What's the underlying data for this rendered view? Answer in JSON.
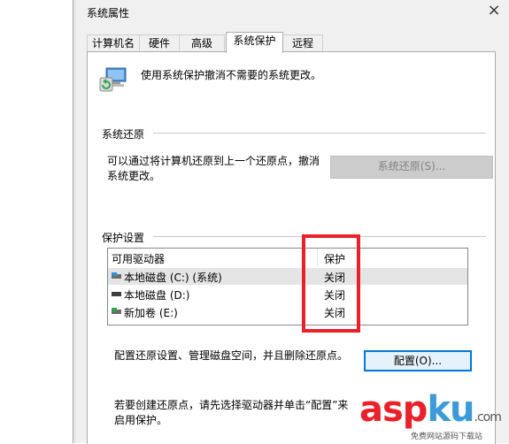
{
  "dialog": {
    "title": "系统属性",
    "close_glyph": "×"
  },
  "tabs": [
    {
      "label": "计算机名"
    },
    {
      "label": "硬件"
    },
    {
      "label": "高级"
    },
    {
      "label": "系统保护"
    },
    {
      "label": "远程"
    }
  ],
  "intro_text": "使用系统保护撤消不需要的系统更改。",
  "system_restore": {
    "heading": "系统还原",
    "line1": "可以通过将计算机还原到上一个还原点，撤消",
    "line2": "系统更改。",
    "button_label": "系统还原(S)..."
  },
  "protection": {
    "heading": "保护设置",
    "col_drive": "可用驱动器",
    "col_protect": "保护",
    "rows": [
      {
        "label": "本地磁盘 (C:) (系统)",
        "value": "关闭"
      },
      {
        "label": "本地磁盘 (D:)",
        "value": "关闭"
      },
      {
        "label": "新加卷 (E:)",
        "value": "关闭"
      }
    ]
  },
  "configure": {
    "text": "配置还原设置、管理磁盘空间，并且删除还原点。",
    "button_label": "配置(O)..."
  },
  "create": {
    "line1": "若要创建还原点，请先选择驱动器并单击“配置”来",
    "line2": "启用保护。"
  },
  "watermark": {
    "brand_a": "asp",
    "brand_b": "ku",
    "suffix": ".com",
    "sub": "免费网站源码下载站"
  },
  "colors": {
    "highlight": "#e8212a",
    "focus": "#0078d7"
  }
}
